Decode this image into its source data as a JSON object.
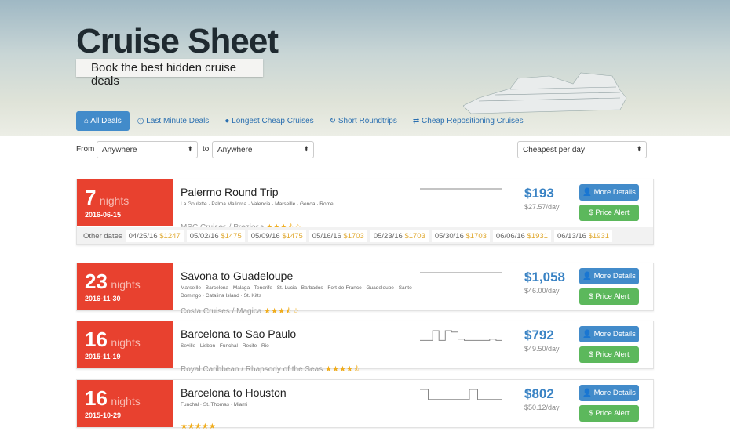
{
  "header": {
    "title": "Cruise Sheet",
    "subtitle": "Book the best hidden cruise deals"
  },
  "tabs": [
    {
      "label": "All Deals",
      "icon": "home-icon",
      "active": true
    },
    {
      "label": "Last Minute Deals",
      "icon": "clock-icon"
    },
    {
      "label": "Longest Cheap Cruises",
      "icon": "globe-icon"
    },
    {
      "label": "Short Roundtrips",
      "icon": "refresh-icon"
    },
    {
      "label": "Cheap Repositioning Cruises",
      "icon": "exchange-icon"
    }
  ],
  "filters": {
    "from_label": "From",
    "from_value": "Anywhere",
    "to_label": "to",
    "to_value": "Anywhere",
    "sort_value": "Cheapest per day"
  },
  "buttons": {
    "details": "More Details",
    "alert": "$ Price Alert"
  },
  "nights_label": "nights",
  "other_dates_label": "Other dates",
  "cruises": [
    {
      "nights": "7",
      "date": "2016-06-15",
      "title": "Palermo Round Trip",
      "ports": "La Goulette · Palma Mallorca · Valencia · Marseille · Genoa · Rome",
      "line": "MSC Cruises / Preziosa",
      "rating": 3.5,
      "price": "$193",
      "per_day": "$27.57/day",
      "spark": [
        5,
        5,
        5,
        5,
        5,
        5,
        5,
        5,
        5,
        5
      ],
      "other_dates": [
        {
          "d": "04/25/16",
          "p": "$1247"
        },
        {
          "d": "05/02/16",
          "p": "$1475"
        },
        {
          "d": "05/09/16",
          "p": "$1475"
        },
        {
          "d": "05/16/16",
          "p": "$1703"
        },
        {
          "d": "05/23/16",
          "p": "$1703"
        },
        {
          "d": "05/30/16",
          "p": "$1703"
        },
        {
          "d": "06/06/16",
          "p": "$1931"
        },
        {
          "d": "06/13/16",
          "p": "$1931"
        }
      ]
    },
    {
      "nights": "23",
      "date": "2016-11-30",
      "title": "Savona to Guadeloupe",
      "ports": "Marseille · Barcelona · Malaga · Tenerife · St. Lucia · Barbados · Fort-de-France · Guadeloupe · Santo Domingo · Catalina Island · St. Kitts",
      "line": "Costa Cruises / Magica",
      "rating": 3.5,
      "price": "$1,058",
      "per_day": "$46.00/day",
      "spark": [
        5,
        5,
        5,
        5,
        5,
        5,
        5,
        5,
        5,
        5
      ]
    },
    {
      "nights": "16",
      "date": "2015-11-19",
      "title": "Barcelona to Sao Paulo",
      "ports": "Seville · Lisbon · Funchal · Recife · Rio",
      "line": "Royal Caribbean / Rhapsody of the Seas",
      "rating": 4.5,
      "price": "$792",
      "per_day": "$49.50/day",
      "spark": [
        2,
        2,
        9,
        2,
        9,
        8,
        3,
        2,
        2,
        2,
        2,
        3,
        2
      ]
    },
    {
      "nights": "16",
      "date": "2015-10-29",
      "title": "Barcelona to Houston",
      "ports": "Funchal · St. Thomas · Miami",
      "line": "",
      "rating": 5,
      "price": "$802",
      "per_day": "$50.12/day",
      "spark": [
        10,
        2,
        2,
        2,
        2,
        2,
        10,
        2,
        2,
        2
      ]
    }
  ]
}
